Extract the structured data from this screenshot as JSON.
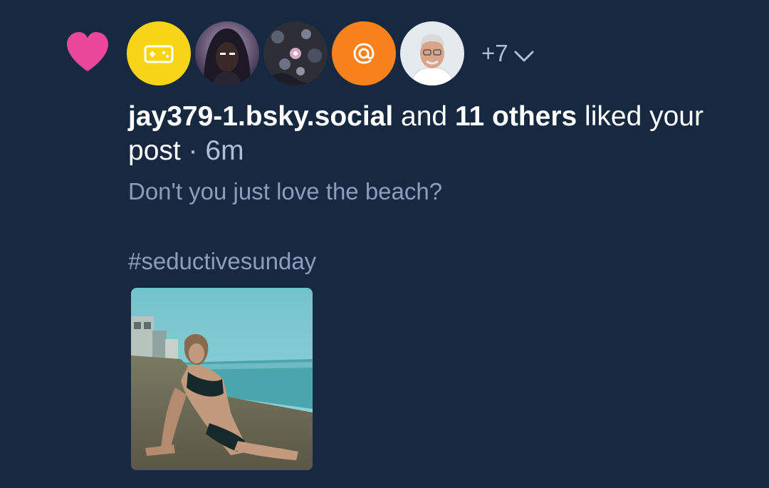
{
  "notification": {
    "type_icon": "heart-icon",
    "heart_color": "#ec4899",
    "likers": [
      {
        "name": "avatar-gamepad",
        "icon": "gamepad-icon",
        "bg": "#f8d416"
      },
      {
        "name": "avatar-hooded-person",
        "icon": "photo",
        "bg": "#2b2238"
      },
      {
        "name": "avatar-floral-pattern",
        "icon": "photo",
        "bg": "#3b3f4a"
      },
      {
        "name": "avatar-at-sign",
        "icon": "at-sign-icon",
        "bg": "#f7821b"
      },
      {
        "name": "avatar-older-man",
        "icon": "photo",
        "bg": "#dfe6ea"
      }
    ],
    "more_count": "+7",
    "actor": "jay379-1.bsky.social",
    "and_text": " and ",
    "others": "11 others",
    "liked_text": " liked your post",
    "separator": " · ",
    "time": "6m"
  },
  "post": {
    "text_line1": "Don't you just love the beach?",
    "text_line2": "#seductivesunday",
    "image_alt": "beach photo"
  },
  "colors": {
    "background": "#172841",
    "primary_text": "#ffffff",
    "secondary_text": "#8b9fbc"
  }
}
